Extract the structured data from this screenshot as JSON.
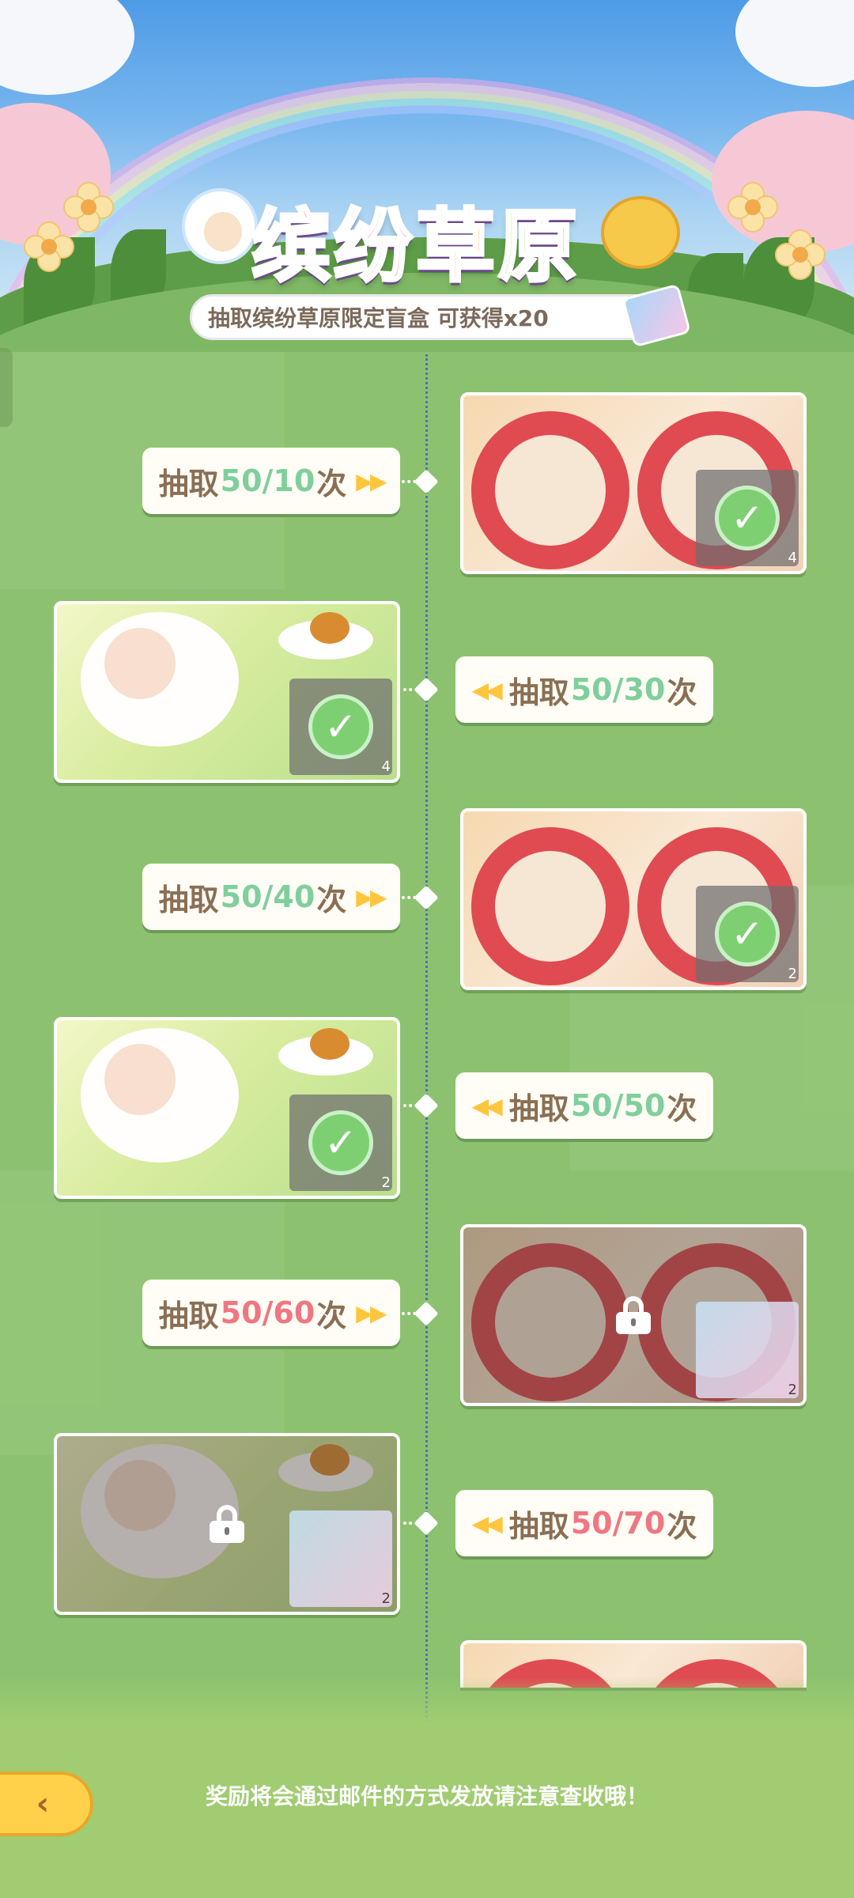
{
  "header": {
    "title_chars": [
      "缤",
      "纷",
      "草",
      "原"
    ],
    "subtitle": "抽取缤纷草原限定盲盒 可获得x20"
  },
  "milestones": [
    {
      "prefix": "抽取",
      "progress": "50/10",
      "suffix": "次",
      "status": "claimed",
      "reward_count": "4",
      "art": "lion-dance"
    },
    {
      "prefix": "抽取",
      "progress": "50/30",
      "suffix": "次",
      "status": "claimed",
      "reward_count": "4",
      "art": "sheep"
    },
    {
      "prefix": "抽取",
      "progress": "50/40",
      "suffix": "次",
      "status": "claimed",
      "reward_count": "2",
      "art": "lion-dance"
    },
    {
      "prefix": "抽取",
      "progress": "50/50",
      "suffix": "次",
      "status": "claimed",
      "reward_count": "2",
      "art": "sheep"
    },
    {
      "prefix": "抽取",
      "progress": "50/60",
      "suffix": "次",
      "status": "locked",
      "reward_count": "2",
      "art": "lion-dance"
    },
    {
      "prefix": "抽取",
      "progress": "50/70",
      "suffix": "次",
      "status": "locked",
      "reward_count": "2",
      "art": "sheep"
    }
  ],
  "arrows": {
    "right": "▶▶",
    "left": "◀◀"
  },
  "check_glyph": "✓",
  "footer": {
    "notice": "奖励将会通过邮件的方式发放请注意查收哦！",
    "back_glyph": "‹"
  },
  "colors": {
    "done_progress": "#7fcf9d",
    "locked_progress": "#f07681",
    "background": "#8cc26f"
  }
}
